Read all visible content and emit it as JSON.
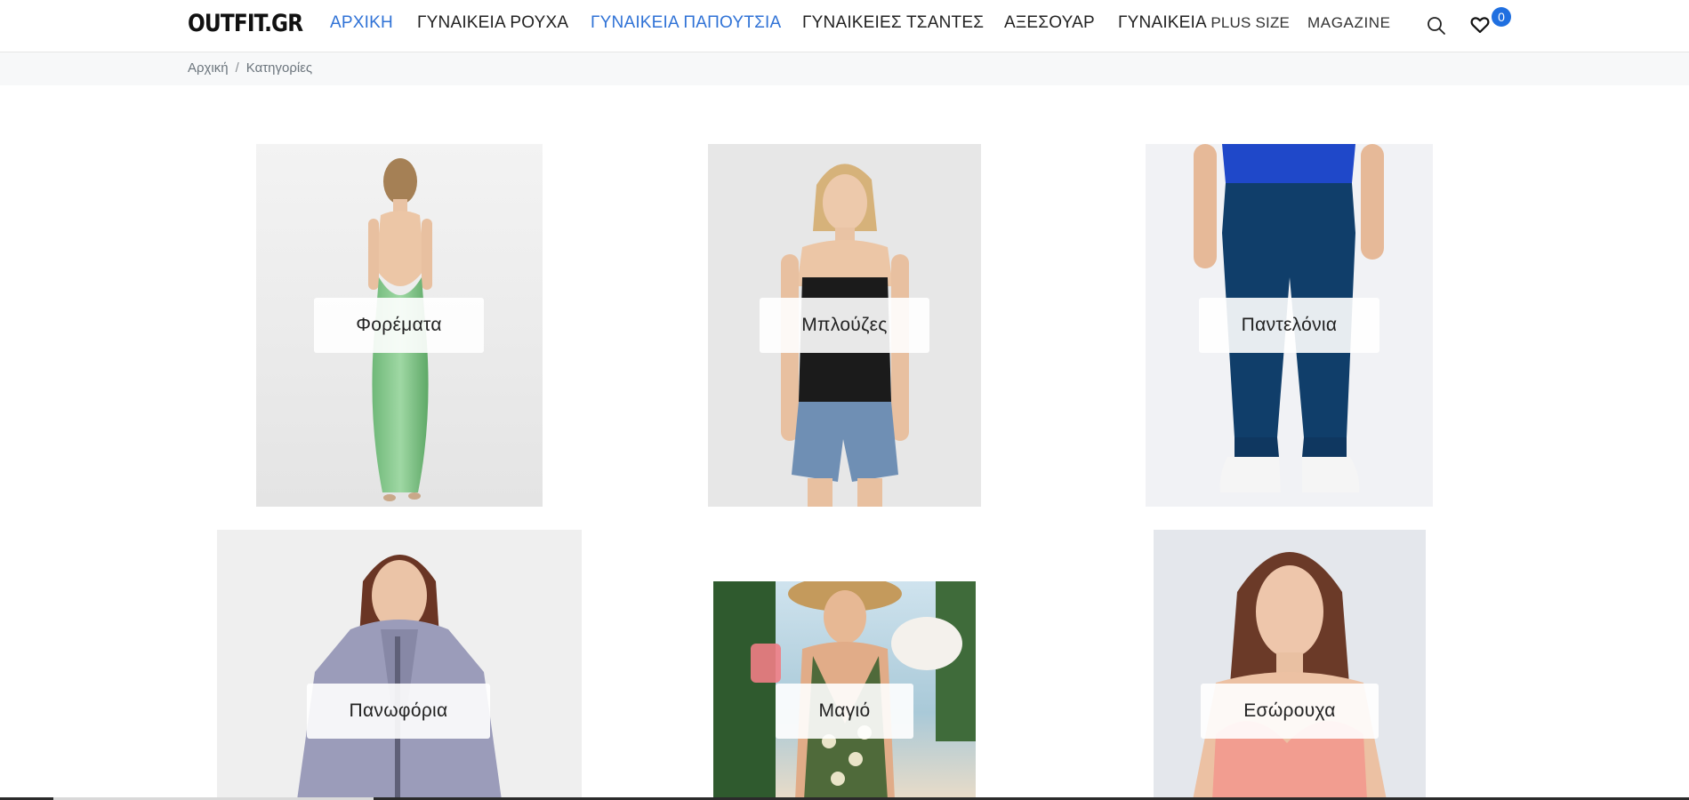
{
  "brand": {
    "logo_text": "OUTFIT.GR"
  },
  "nav": {
    "items": [
      {
        "label": "ΑΡΧΙΚΗ",
        "active": true
      },
      {
        "label": "ΓΥΝΑΙΚΕΙΑ ΡΟΥΧΑ",
        "active": false
      },
      {
        "label": "ΓΥΝΑΙΚΕΙΑ ΠΑΠΟΥΤΣΙΑ",
        "active": true
      },
      {
        "label": "ΓΥΝΑΙΚΕΙΕΣ ΤΣΑΝΤΕΣ",
        "active": false
      },
      {
        "label": "ΑΞΕΣΟΥΑΡ",
        "active": false
      },
      {
        "label_main": "ΓΥΝΑΙΚΕΙΑ",
        "label_suffix": "PLUS SIZE",
        "active": false
      },
      {
        "label": "MAGAZINE",
        "active": false
      }
    ],
    "accent_color": "#2f72d6"
  },
  "header_icons": {
    "search": "search-icon",
    "wishlist": "heart-icon",
    "wishlist_count": "0",
    "badge_color": "#1f6fe0"
  },
  "breadcrumb": {
    "home": "Αρχική",
    "separator": "/",
    "current": "Κατηγορίες"
  },
  "categories": [
    {
      "label": "Φορέματα",
      "image": "woman in green backless satin maxi dress, back view"
    },
    {
      "label": "Μπλούζες",
      "image": "woman in black camisole and denim shorts"
    },
    {
      "label": "Παντελόνια",
      "image": "navy jeans with white sneakers"
    },
    {
      "label": "Πανωφόρια",
      "image": "woman in lilac hooded jacket"
    },
    {
      "label": "Μαγιό",
      "image": "woman in patterned one-piece swimsuit with straw hat on beach"
    },
    {
      "label": "Εσώρουχα",
      "image": "woman in pink lace bra"
    }
  ]
}
